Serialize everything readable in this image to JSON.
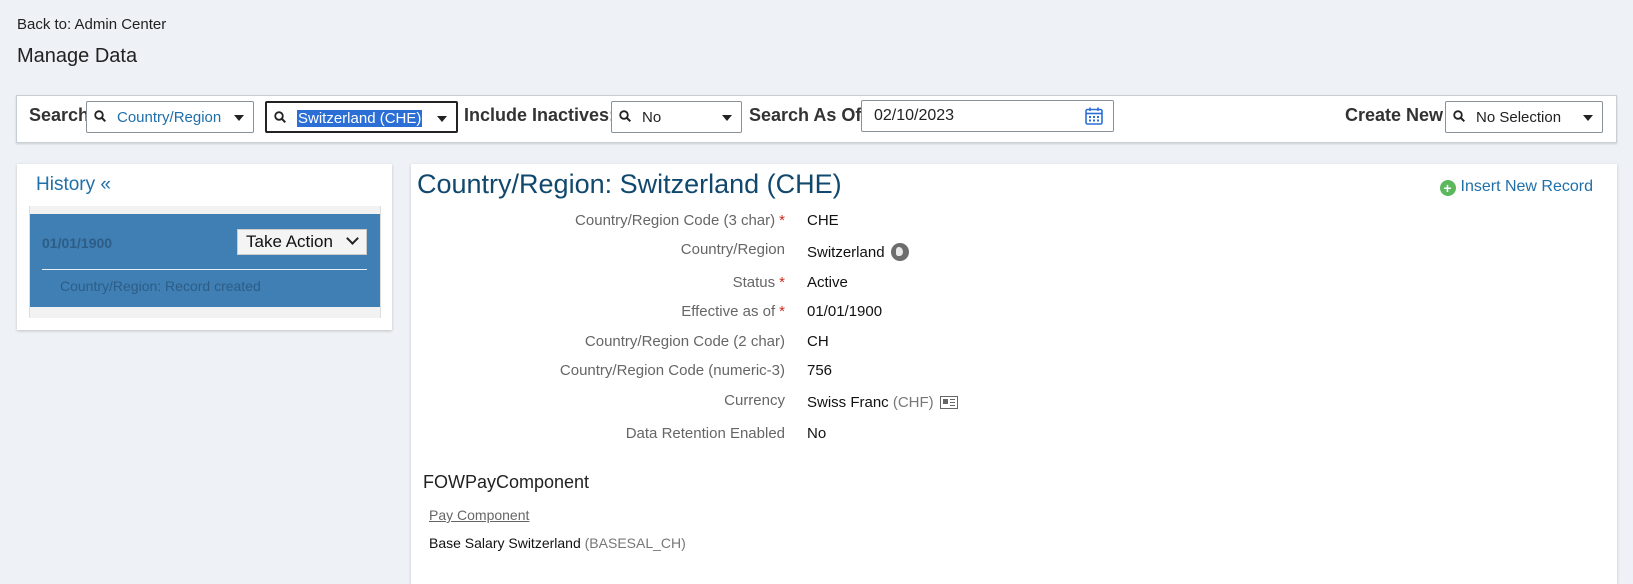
{
  "header": {
    "back_link": "Back to: Admin Center",
    "page_title": "Manage Data"
  },
  "searchbar": {
    "search_label": "Search",
    "object_type": "Country/Region",
    "object_value": "Switzerland (CHE)",
    "include_inactives_label": "Include Inactives:",
    "include_inactives_value": "No",
    "search_as_of_label": "Search As Of:",
    "search_as_of_value": "02/10/2023",
    "create_new_label": "Create New",
    "create_new_value": "No Selection"
  },
  "history": {
    "title": "History «",
    "records": [
      {
        "date": "01/01/1900",
        "action_label": "Take Action",
        "note": "Country/Region: Record created"
      }
    ]
  },
  "detail": {
    "title": "Country/Region: Switzerland (CHE)",
    "insert_new_label": "Insert New Record",
    "fields": [
      {
        "label": "Country/Region Code (3 char)",
        "required": "*",
        "value": "CHE"
      },
      {
        "label": "Country/Region",
        "required": "",
        "value": "Switzerland"
      },
      {
        "label": "Status",
        "required": "*",
        "value": "Active"
      },
      {
        "label": "Effective as of",
        "required": "*",
        "value": "01/01/1900"
      },
      {
        "label": "Country/Region Code (2 char)",
        "required": "",
        "value": "CH"
      },
      {
        "label": "Country/Region Code (numeric-3)",
        "required": "",
        "value": "756"
      },
      {
        "label": "Currency",
        "required": "",
        "value": "Swiss Franc",
        "value_code": "(CHF)"
      },
      {
        "label": "Data Retention Enabled",
        "required": "",
        "value": "No"
      }
    ],
    "section_title": "FOWPayComponent",
    "pay_component_label": "Pay Component",
    "pay_component_value": "Base Salary Switzerland",
    "pay_component_code": "(BASESAL_CH)"
  },
  "colors": {
    "accent_link": "#1f6fa8",
    "title_blue": "#11486e",
    "history_selected": "#3f7fb4",
    "required": "#d0271d",
    "insert_plus": "#5cb85c"
  },
  "icons": [
    "search-icon",
    "dropdown-caret-icon",
    "calendar-icon",
    "add-circle-icon",
    "chevron-down-icon",
    "globe-icon",
    "business-card-icon"
  ]
}
